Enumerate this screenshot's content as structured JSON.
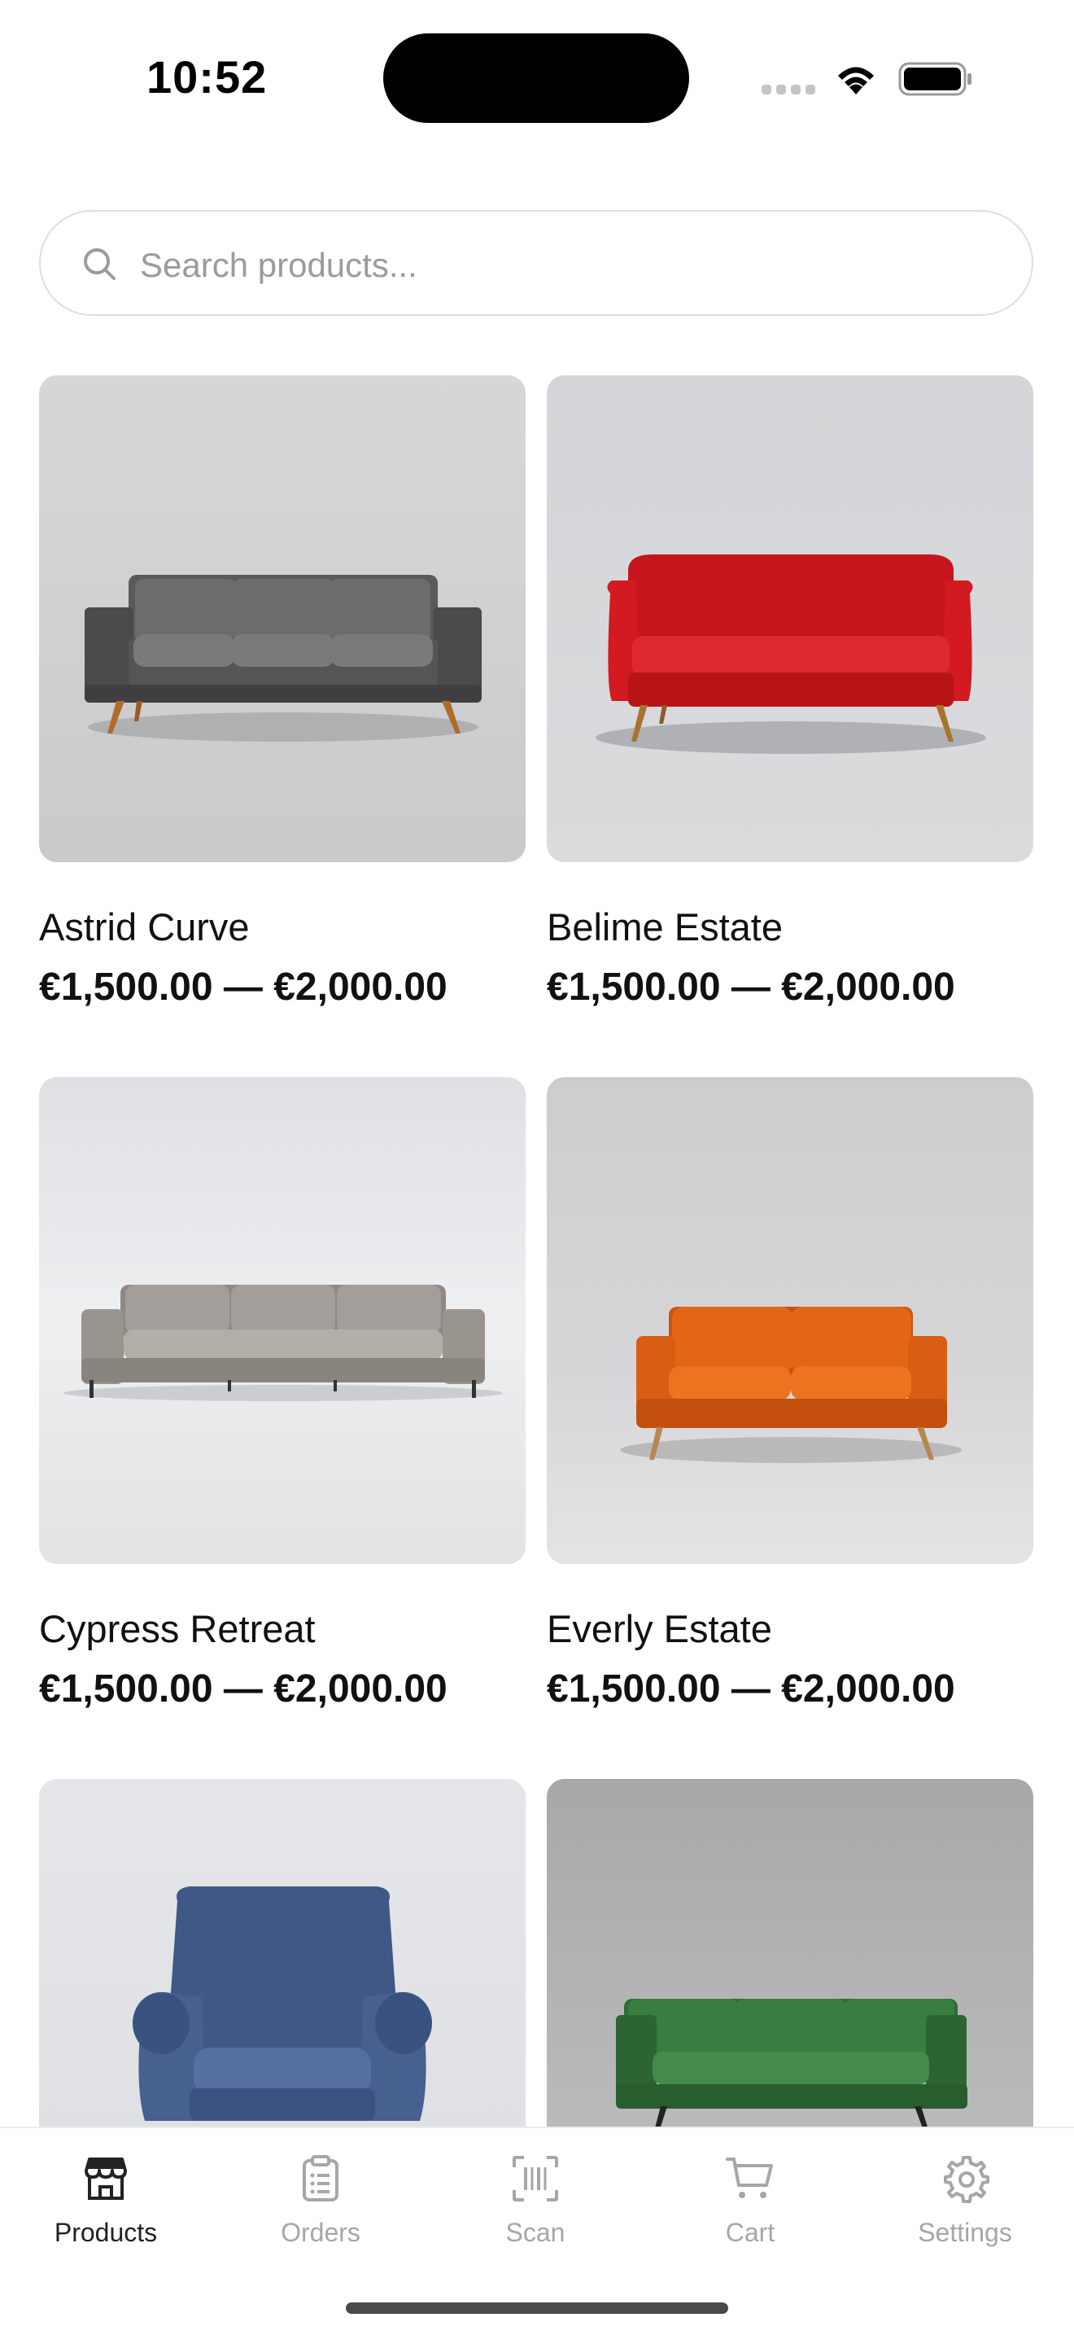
{
  "status_bar": {
    "time": "10:52"
  },
  "search": {
    "placeholder": "Search products..."
  },
  "products": [
    {
      "name": "Astrid Curve",
      "price": "€1,500.00 — €2,000.00",
      "image": "gray three-seat sofa"
    },
    {
      "name": "Belime Estate",
      "price": "€1,500.00 — €2,000.00",
      "image": "red loveseat sofa"
    },
    {
      "name": "Cypress Retreat",
      "price": "€1,500.00 — €2,000.00",
      "image": "taupe three-seat sofa"
    },
    {
      "name": "Everly Estate",
      "price": "€1,500.00 — €2,000.00",
      "image": "orange loveseat sofa"
    },
    {
      "name": "",
      "price": "",
      "image": "blue wingback armchair"
    },
    {
      "name": "",
      "price": "",
      "image": "green three-seat sofa"
    }
  ],
  "tabs": [
    {
      "label": "Products",
      "icon": "storefront-icon",
      "active": true
    },
    {
      "label": "Orders",
      "icon": "clipboard-icon",
      "active": false
    },
    {
      "label": "Scan",
      "icon": "barcode-scan-icon",
      "active": false
    },
    {
      "label": "Cart",
      "icon": "cart-icon",
      "active": false
    },
    {
      "label": "Settings",
      "icon": "gear-icon",
      "active": false
    }
  ],
  "colors": {
    "active_tab": "#222222",
    "inactive_tab": "#a6a6a6",
    "search_border": "#dedede",
    "placeholder": "#9b9b9b"
  }
}
